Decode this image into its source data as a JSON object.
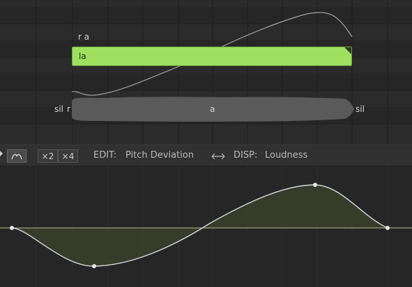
{
  "piano_roll": {
    "lyric_upper": "r a",
    "note": {
      "lyric": "la"
    },
    "phonemes": {
      "left_sil": "sil",
      "r": "r",
      "a": "a",
      "right_sil": "sil"
    }
  },
  "toolbar": {
    "x2_label": "×2",
    "x4_label": "×4",
    "edit_label": "EDIT:",
    "edit_value": "Pitch Deviation",
    "swap_icon": "swap-arrows-icon",
    "disp_label": "DISP:",
    "disp_value": "Loudness"
  },
  "colors": {
    "note_fill": "#9fe060",
    "curve": "#dddddd",
    "area_fill": "#3a3f2c"
  }
}
